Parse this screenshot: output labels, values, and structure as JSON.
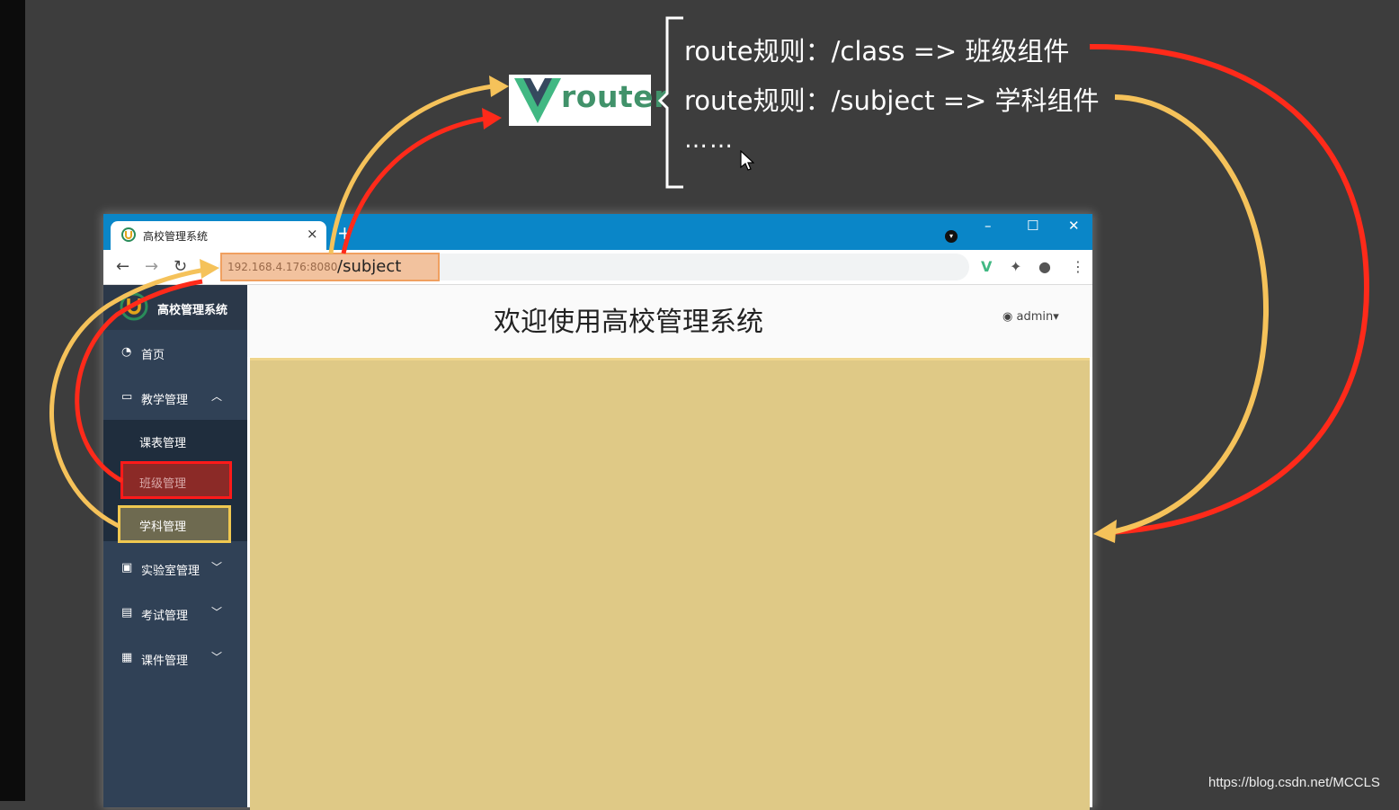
{
  "router": {
    "logo_text": "router",
    "rules": [
      "route规则：/class =>  班级组件",
      "route规则：/subject => 学科组件",
      "……"
    ]
  },
  "browser": {
    "tab_title": "高校管理系统",
    "tab_close": "×",
    "new_tab": "+",
    "window_controls": [
      "–",
      "☐",
      "✕"
    ],
    "url_host": "192.168.4.176:8080",
    "url_path": "/subject"
  },
  "sidebar": {
    "brand": "高校管理系统",
    "items": [
      {
        "icon": "dashboard-icon",
        "label": "首页"
      },
      {
        "icon": "monitor-icon",
        "label": "教学管理",
        "expanded": true
      },
      {
        "label": "课表管理"
      },
      {
        "label": "班级管理",
        "highlight": "#ff1a1a"
      },
      {
        "label": "学科管理",
        "highlight": "#f0c850"
      },
      {
        "icon": "lab-icon",
        "label": "实验室管理"
      },
      {
        "icon": "exam-icon",
        "label": "考试管理"
      },
      {
        "icon": "courseware-icon",
        "label": "课件管理"
      }
    ]
  },
  "header": {
    "title": "欢迎使用高校管理系统",
    "user": "admin"
  },
  "colors": {
    "arrow_red": "#ff2a1a",
    "arrow_yellow": "#f5c25a",
    "content_bg": "#dfc986",
    "sidebar_bg": "#304156",
    "titlebar": "#0a86c8"
  },
  "watermark": "https://blog.csdn.net/MCCLS"
}
